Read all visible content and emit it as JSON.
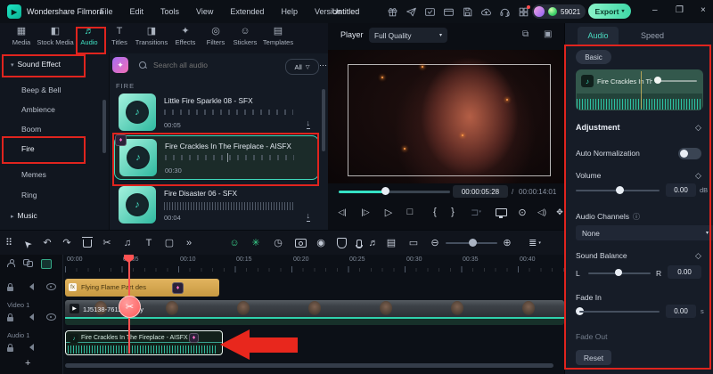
{
  "titlebar": {
    "brand": "Wondershare Filmora",
    "menus": [
      "File",
      "Edit",
      "Tools",
      "View",
      "Extended",
      "Help",
      "Version"
    ],
    "project_title": "Untitled",
    "coin_balance": "59021",
    "export_label": "Export",
    "window_minimize": "–",
    "window_restore": "❐",
    "window_close": "×"
  },
  "media_panel": {
    "tabs": [
      {
        "label": "Media"
      },
      {
        "label": "Stock Media"
      },
      {
        "label": "Audio"
      },
      {
        "label": "Titles"
      },
      {
        "label": "Transitions"
      },
      {
        "label": "Effects"
      },
      {
        "label": "Filters"
      },
      {
        "label": "Stickers"
      },
      {
        "label": "Templates"
      }
    ],
    "sidebar": [
      {
        "label": "Sound Effect"
      },
      {
        "label": "Beep & Bell"
      },
      {
        "label": "Ambience"
      },
      {
        "label": "Boom"
      },
      {
        "label": "Fire"
      },
      {
        "label": "Memes"
      },
      {
        "label": "Ring"
      },
      {
        "label": "Music"
      }
    ],
    "search_placeholder": "Search all audio",
    "filter_label": "All",
    "section_header": "FIRE",
    "items": [
      {
        "title": "Little Fire Sparkle 08 - SFX",
        "duration": "00:05"
      },
      {
        "title": "Fire Crackles In The Fireplace - AISFX",
        "duration": "00:30"
      },
      {
        "title": "Fire Disaster 06 - SFX",
        "duration": "00:04"
      }
    ]
  },
  "player": {
    "label": "Player",
    "quality": "Full Quality",
    "current_time": "00:00:05:28",
    "separator": "/",
    "total_time": "00:00:14:01"
  },
  "properties_panel": {
    "tabs": [
      "Audio",
      "Speed"
    ],
    "badge": "Basic",
    "clip_title": "Fire Crackles In The ...",
    "adjustment_label": "Adjustment",
    "auto_normalization_label": "Auto Normalization",
    "volume": {
      "label": "Volume",
      "value": "0.00",
      "unit": "dB"
    },
    "audio_channels": {
      "label": "Audio Channels",
      "value": "None"
    },
    "sound_balance": {
      "label": "Sound Balance",
      "left": "L",
      "right": "R",
      "value": "0.00"
    },
    "fade_in": {
      "label": "Fade In",
      "value": "0.00",
      "unit": "s"
    },
    "fade_out_label": "Fade Out",
    "reset_label": "Reset"
  },
  "timeline": {
    "ruler": [
      "00:00",
      "00:05",
      "00:10",
      "00:15",
      "00:20",
      "00:25",
      "00:30",
      "00:35",
      "00:40"
    ],
    "add_track": "+",
    "tracks": [
      {
        "name": "",
        "clip": "Flying Flame Part des"
      },
      {
        "name": "Video 1",
        "clip": "1J5138-761273_tiny"
      },
      {
        "name": "Audio 1",
        "clip": "Fire Crackles In The Fireplace - AISFX"
      }
    ]
  },
  "icons": {
    "logo": "▶",
    "tab_media": "▦",
    "tab_stock": "◧",
    "tab_audio": "♬",
    "tab_titles": "T",
    "tab_transitions": "◨",
    "tab_effects": "✦",
    "tab_filters": "◎",
    "tab_stickers": "☺",
    "tab_templates": "▤",
    "arrow_expanded": "▾",
    "arrow_collapsed": "▸",
    "chevron_down": "▾",
    "more_h": "⋯",
    "funnel": "▽",
    "download": "↓",
    "ai_sparkle": "✦",
    "music_note": "♪",
    "gem": "♦",
    "grid": "⠿",
    "cursor": "➤",
    "undo": "↶",
    "redo": "↷",
    "scissors": "✂",
    "beat": "♫",
    "text_tool": "T",
    "crop": "▢",
    "more": "»",
    "emoji": "☺",
    "snap": "✳",
    "speed_clock": "◷",
    "render_play": "◉",
    "playlist": "♬",
    "film": "▤",
    "marker": "▭",
    "zoom_out": "⊖",
    "zoom_in": "⊕",
    "tracks_menu": "≣",
    "prev_frame": "◁|",
    "next_frame": "|▷",
    "play": "▷",
    "stop": "□",
    "mark_in": "{",
    "mark_out": "}",
    "range": "⊐",
    "snapshot": "⊙",
    "volume_spk": "◁)",
    "expand": "✥",
    "compare": "⧉",
    "frame": "▣",
    "info": "ⓘ",
    "diamond": "◇"
  }
}
